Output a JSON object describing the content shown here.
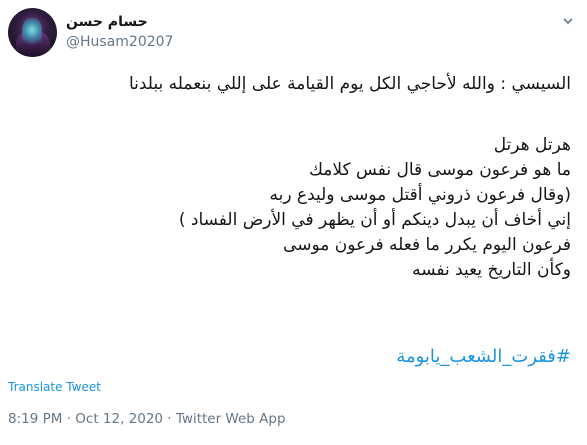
{
  "author": {
    "display_name": "حسام حسن",
    "handle": "@Husam20207"
  },
  "tweet": {
    "line1": "السيسي : والله لأحاجي الكل يوم القيامة على إللي بنعمله ببلدنا",
    "line2": "هرتل هرتل",
    "line3": "ما هو فرعون موسى قال نفس كلامك",
    "line4": "(وقال فرعون ذروني أقتل موسى وليدع ربه",
    "line5": "إني أخاف أن يبدل دينكم أو أن يظهر في الأرض الفساد )",
    "line6": "فرعون اليوم يكرر ما فعله فرعون موسى",
    "line7": "وكأن التاريخ يعيد نفسه",
    "hashtag": "#فقرت_الشعب_يابومة"
  },
  "translate_label": "Translate Tweet",
  "meta": "8:19 PM · Oct 12, 2020 · Twitter Web App",
  "colors": {
    "link": "#1b95e0",
    "secondary_text": "#657786",
    "primary_text": "#14171a"
  },
  "icons": {
    "menu": "chevron-down-icon"
  }
}
